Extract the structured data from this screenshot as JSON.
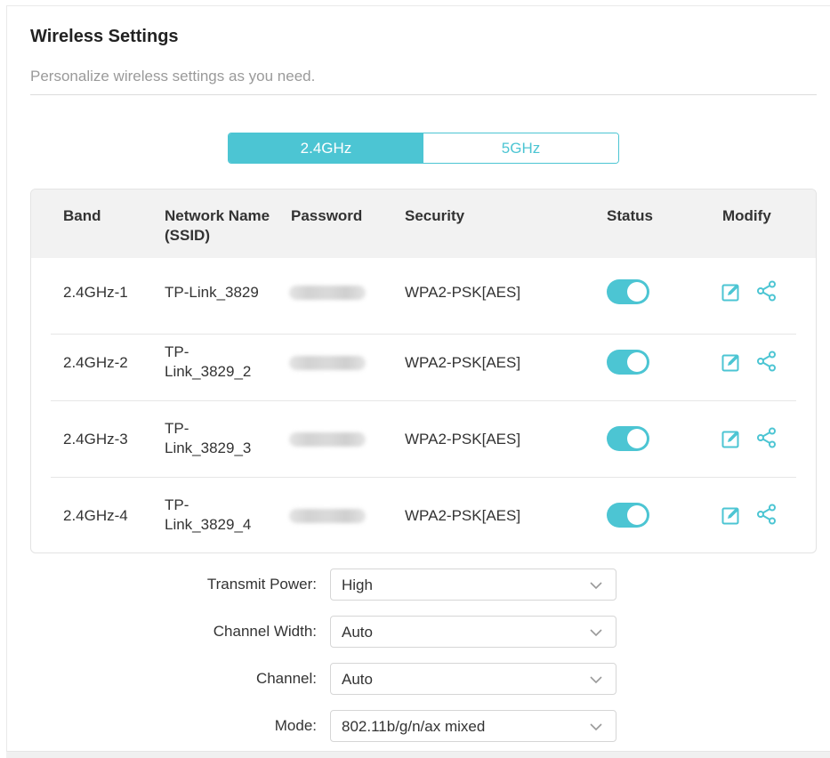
{
  "header": {
    "title": "Wireless Settings",
    "subtitle": "Personalize wireless settings as you need."
  },
  "band_tabs": [
    {
      "label": "2.4GHz",
      "active": true
    },
    {
      "label": "5GHz",
      "active": false
    }
  ],
  "table": {
    "headers": {
      "band": "Band",
      "ssid_line1": "Network Name",
      "ssid_line2": "(SSID)",
      "password": "Password",
      "security": "Security",
      "status": "Status",
      "modify": "Modify"
    },
    "rows": [
      {
        "band": "2.4GHz-1",
        "ssid_line1": "TP-Link_3829",
        "ssid_line2": "",
        "security": "WPA2-PSK[AES]",
        "status": "on"
      },
      {
        "band": "2.4GHz-2",
        "ssid_line1": "TP-",
        "ssid_line2": "Link_3829_2",
        "security": "WPA2-PSK[AES]",
        "status": "on"
      },
      {
        "band": "2.4GHz-3",
        "ssid_line1": "TP-",
        "ssid_line2": "Link_3829_3",
        "security": "WPA2-PSK[AES]",
        "status": "on"
      },
      {
        "band": "2.4GHz-4",
        "ssid_line1": "TP-",
        "ssid_line2": "Link_3829_4",
        "security": "WPA2-PSK[AES]",
        "status": "on"
      }
    ]
  },
  "form": {
    "transmit_power": {
      "label": "Transmit Power:",
      "value": "High"
    },
    "channel_width": {
      "label": "Channel Width:",
      "value": "Auto"
    },
    "channel": {
      "label": "Channel:",
      "value": "Auto"
    },
    "mode": {
      "label": "Mode:",
      "value": "802.11b/g/n/ax mixed"
    }
  },
  "icons": {
    "edit": "edit-icon",
    "share": "share-icon",
    "dropdown": "chevron-down-icon"
  },
  "colors": {
    "accent": "#4cc5d3",
    "header_bg": "#f2f2f2"
  }
}
